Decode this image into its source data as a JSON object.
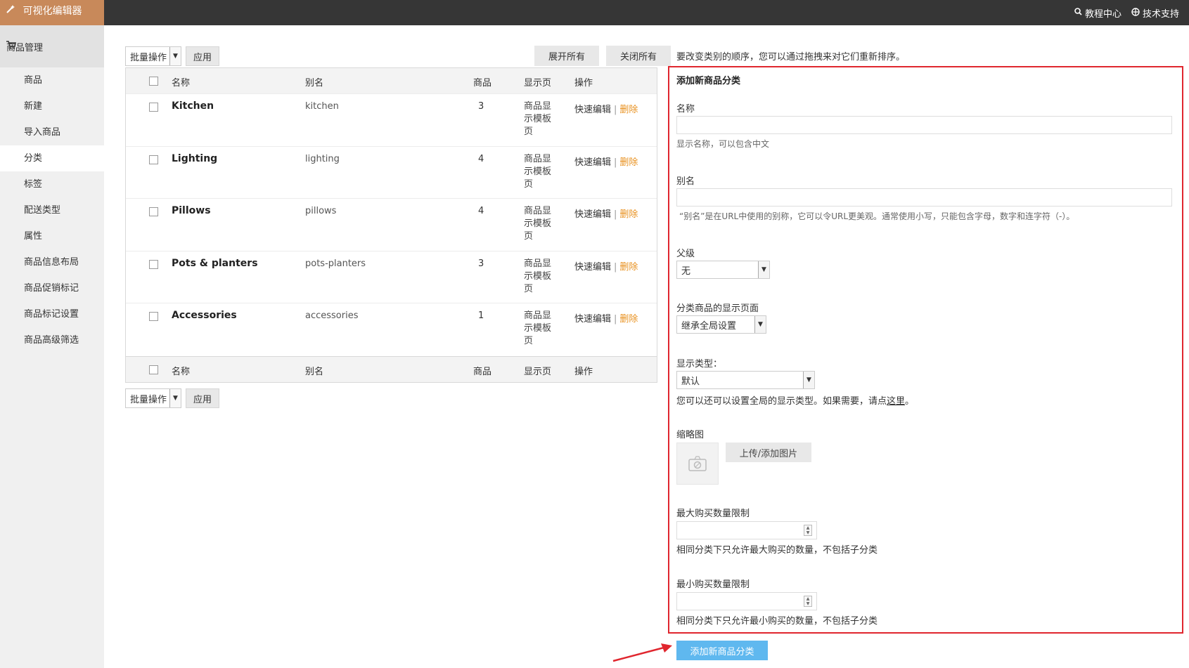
{
  "app": {
    "brand": "可视化编辑器",
    "brand_icon": "magic-wand-icon"
  },
  "top_links": [
    {
      "label": "教程中心",
      "icon": "search-icon"
    },
    {
      "label": "技术支持",
      "icon": "support-globe-icon"
    }
  ],
  "sidebar": {
    "section_label": "商品管理",
    "section_icon": "cart-icon",
    "items": [
      {
        "label": "商品"
      },
      {
        "label": "新建"
      },
      {
        "label": "导入商品"
      },
      {
        "label": "分类",
        "active": true
      },
      {
        "label": "标签"
      },
      {
        "label": "配送类型"
      },
      {
        "label": "属性"
      },
      {
        "label": "商品信息布局"
      },
      {
        "label": "商品促销标记"
      },
      {
        "label": "商品标记设置"
      },
      {
        "label": "商品高级筛选"
      }
    ]
  },
  "bulk": {
    "select_value": "批量操作",
    "apply_label": "应用"
  },
  "toolbar": {
    "expand_all": "展开所有",
    "collapse_all": "关闭所有"
  },
  "table": {
    "columns": {
      "name": "名称",
      "slug": "别名",
      "count": "商品",
      "template": "显示页",
      "actions": "操作"
    },
    "rows": [
      {
        "name": "Kitchen",
        "slug": "kitchen",
        "count": "3",
        "template": "商品显示模板页"
      },
      {
        "name": "Lighting",
        "slug": "lighting",
        "count": "4",
        "template": "商品显示模板页"
      },
      {
        "name": "Pillows",
        "slug": "pillows",
        "count": "4",
        "template": "商品显示模板页"
      },
      {
        "name": "Pots & planters",
        "slug": "pots-planters",
        "count": "3",
        "template": "商品显示模板页"
      },
      {
        "name": "Accessories",
        "slug": "accessories",
        "count": "1",
        "template": "商品显示模板页"
      }
    ],
    "row_actions": {
      "quick_edit": "快速编辑",
      "separator": "|",
      "delete": "删除"
    }
  },
  "form": {
    "hint_top": "要改变类别的顺序，您可以通过拖拽来对它们重新排序。",
    "title": "添加新商品分类",
    "name_label": "名称",
    "name_value": "",
    "name_help": "显示名称，可以包含中文",
    "slug_label": "别名",
    "slug_value": "",
    "slug_help": "“别名”是在URL中使用的别称，它可以令URL更美观。通常使用小写，只能包含字母，数字和连字符（-）。",
    "parent_label": "父级",
    "parent_value": "无",
    "display_page_label": "分类商品的显示页面",
    "display_page_value": "继承全局设置",
    "display_type_label": "显示类型：",
    "display_type_value": "默认",
    "display_type_help": "您可以还可以设置全局的显示类型。如果需要，请点",
    "display_type_link": "这里",
    "display_type_help_end": "。",
    "thumbnail_label": "缩略图",
    "thumbnail_icon": "image-placeholder-icon",
    "upload_label": "上传/添加图片",
    "max_label": "最大购买数量限制",
    "max_value": "",
    "max_help": "相同分类下只允许最大购买的数量，不包括子分类",
    "min_label": "最小购买数量限制",
    "min_value": "",
    "min_help": "相同分类下只允许最小购买的数量，不包括子分类",
    "submit_label": "添加新商品分类"
  },
  "annotation": {
    "highlight_color": "#e0262e",
    "arrow_color": "#e0262e"
  }
}
